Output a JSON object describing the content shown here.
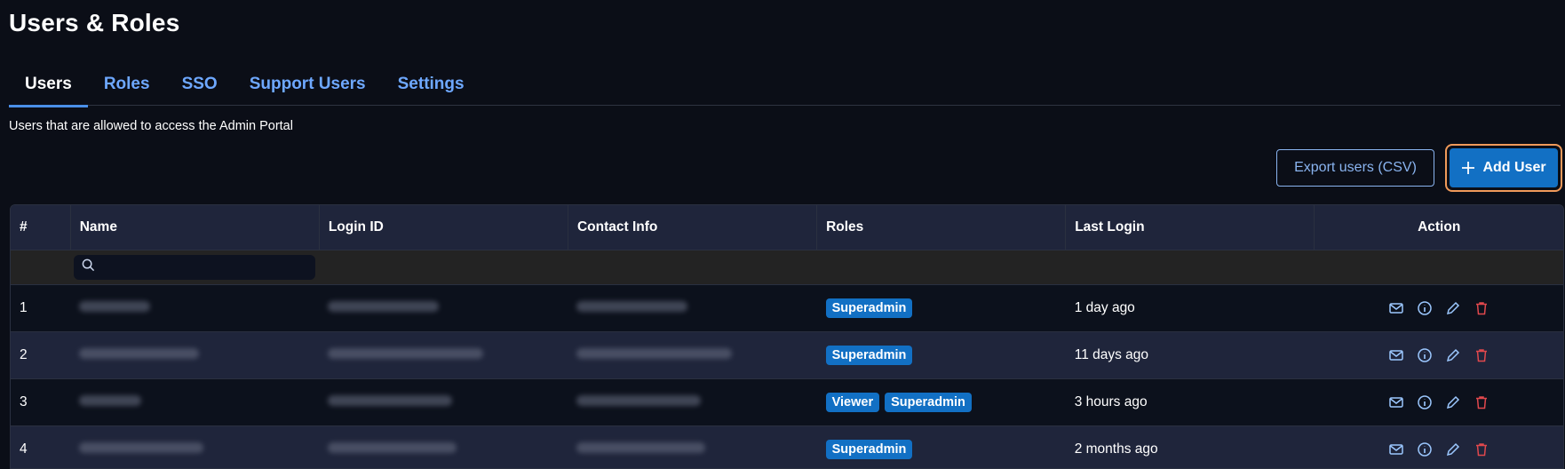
{
  "page": {
    "title": "Users & Roles",
    "subtitle": "Users that are allowed to access the Admin Portal"
  },
  "tabs": [
    {
      "label": "Users",
      "active": true
    },
    {
      "label": "Roles",
      "active": false
    },
    {
      "label": "SSO",
      "active": false
    },
    {
      "label": "Support Users",
      "active": false
    },
    {
      "label": "Settings",
      "active": false
    }
  ],
  "toolbar": {
    "export_label": "Export users (CSV)",
    "add_label": "Add User"
  },
  "table": {
    "columns": [
      "#",
      "Name",
      "Login ID",
      "Contact Info",
      "Roles",
      "Last Login",
      "Action"
    ],
    "rows": [
      {
        "num": "1",
        "roles": [
          "Superadmin"
        ],
        "last_login": "1 day ago"
      },
      {
        "num": "2",
        "roles": [
          "Superadmin"
        ],
        "last_login": "11 days ago"
      },
      {
        "num": "3",
        "roles": [
          "Viewer",
          "Superadmin"
        ],
        "last_login": "3 hours ago"
      },
      {
        "num": "4",
        "roles": [
          "Superadmin"
        ],
        "last_login": "2 months ago"
      }
    ]
  },
  "colors": {
    "accent": "#1270c4",
    "tab_link": "#6ea8ff",
    "delete_icon": "#e0484d",
    "focus_ring": "#f09a5a"
  }
}
